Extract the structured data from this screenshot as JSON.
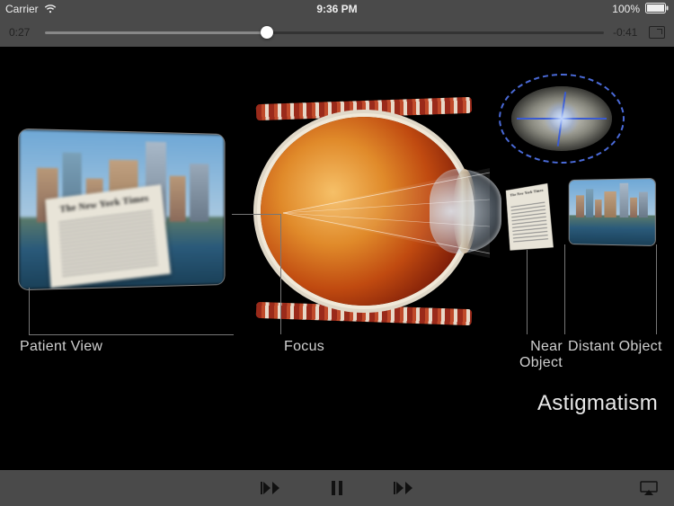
{
  "status": {
    "carrier": "Carrier",
    "time": "9:36 PM",
    "battery": "100%"
  },
  "player": {
    "elapsed": "0:27",
    "remaining": "-0:41",
    "progress_pct": 39.7
  },
  "labels": {
    "patient_view": "Patient View",
    "focus": "Focus",
    "near_object": "Near Object",
    "distant_object": "Distant Object",
    "title": "Astigmatism"
  },
  "icons": {
    "wifi": "wifi-icon",
    "battery": "battery-icon",
    "fullscreen": "fullscreen-icon",
    "prev": "previous-track-icon",
    "pause": "pause-icon",
    "next": "next-track-icon",
    "airplay": "airplay-icon"
  }
}
